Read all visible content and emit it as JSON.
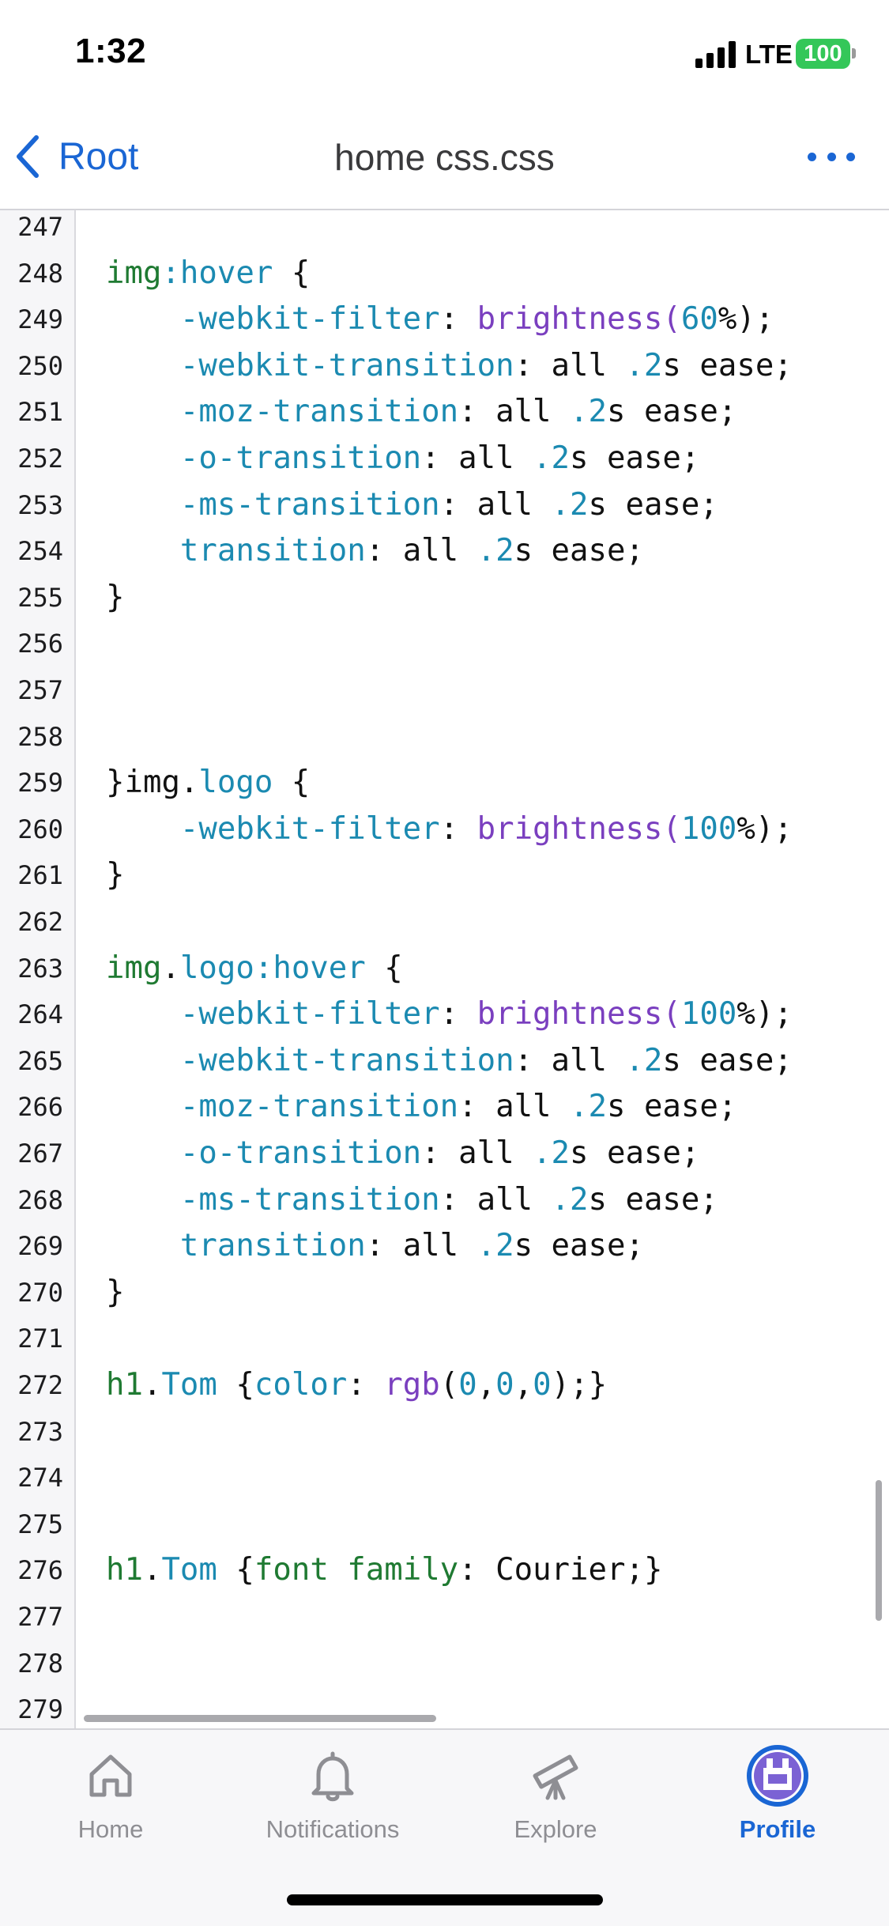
{
  "status_bar": {
    "time": "1:32",
    "network": "LTE",
    "battery": "100",
    "battery_color": "#34c759"
  },
  "nav": {
    "back_label": "Root",
    "title": "home css.css",
    "more_icon": "ellipsis-icon"
  },
  "colors": {
    "accent": "#1a66d4",
    "selector": "#1f7a32",
    "property": "#1b8ab1",
    "function": "#7a3fbf",
    "number": "#1b8ab1"
  },
  "code": {
    "lines": [
      {
        "num": "247",
        "tokens": []
      },
      {
        "num": "248",
        "tokens": [
          {
            "t": "img",
            "c": "sel"
          },
          {
            "t": ":hover",
            "c": "prop"
          },
          {
            "t": " {",
            "c": "plain"
          }
        ]
      },
      {
        "num": "249",
        "tokens": [
          {
            "t": "    -webkit-filter",
            "c": "prop"
          },
          {
            "t": ": ",
            "c": "plain"
          },
          {
            "t": "brightness",
            "c": "fn"
          },
          {
            "t": "(",
            "c": "fn"
          },
          {
            "t": "60",
            "c": "num"
          },
          {
            "t": "%);",
            "c": "plain"
          }
        ]
      },
      {
        "num": "250",
        "tokens": [
          {
            "t": "    -webkit-transition",
            "c": "prop"
          },
          {
            "t": ": all ",
            "c": "plain"
          },
          {
            "t": ".2",
            "c": "num"
          },
          {
            "t": "s ease;",
            "c": "plain"
          }
        ]
      },
      {
        "num": "251",
        "tokens": [
          {
            "t": "    -moz-transition",
            "c": "prop"
          },
          {
            "t": ": all ",
            "c": "plain"
          },
          {
            "t": ".2",
            "c": "num"
          },
          {
            "t": "s ease;",
            "c": "plain"
          }
        ]
      },
      {
        "num": "252",
        "tokens": [
          {
            "t": "    -o-transition",
            "c": "prop"
          },
          {
            "t": ": all ",
            "c": "plain"
          },
          {
            "t": ".2",
            "c": "num"
          },
          {
            "t": "s ease;",
            "c": "plain"
          }
        ]
      },
      {
        "num": "253",
        "tokens": [
          {
            "t": "    -ms-transition",
            "c": "prop"
          },
          {
            "t": ": all ",
            "c": "plain"
          },
          {
            "t": ".2",
            "c": "num"
          },
          {
            "t": "s ease;",
            "c": "plain"
          }
        ]
      },
      {
        "num": "254",
        "tokens": [
          {
            "t": "    transition",
            "c": "prop"
          },
          {
            "t": ": all ",
            "c": "plain"
          },
          {
            "t": ".2",
            "c": "num"
          },
          {
            "t": "s ease;",
            "c": "plain"
          }
        ]
      },
      {
        "num": "255",
        "tokens": [
          {
            "t": "}",
            "c": "plain"
          }
        ]
      },
      {
        "num": "256",
        "tokens": []
      },
      {
        "num": "257",
        "tokens": []
      },
      {
        "num": "258",
        "tokens": []
      },
      {
        "num": "259",
        "tokens": [
          {
            "t": "}img.",
            "c": "plain"
          },
          {
            "t": "logo",
            "c": "prop"
          },
          {
            "t": " {",
            "c": "plain"
          }
        ]
      },
      {
        "num": "260",
        "tokens": [
          {
            "t": "    -webkit-filter",
            "c": "prop"
          },
          {
            "t": ": ",
            "c": "plain"
          },
          {
            "t": "brightness",
            "c": "fn"
          },
          {
            "t": "(",
            "c": "fn"
          },
          {
            "t": "100",
            "c": "num"
          },
          {
            "t": "%);",
            "c": "plain"
          }
        ]
      },
      {
        "num": "261",
        "tokens": [
          {
            "t": "}",
            "c": "plain"
          }
        ]
      },
      {
        "num": "262",
        "tokens": []
      },
      {
        "num": "263",
        "tokens": [
          {
            "t": "img",
            "c": "sel"
          },
          {
            "t": ".",
            "c": "plain"
          },
          {
            "t": "logo",
            "c": "prop"
          },
          {
            "t": ":hover",
            "c": "prop"
          },
          {
            "t": " {",
            "c": "plain"
          }
        ]
      },
      {
        "num": "264",
        "tokens": [
          {
            "t": "    -webkit-filter",
            "c": "prop"
          },
          {
            "t": ": ",
            "c": "plain"
          },
          {
            "t": "brightness",
            "c": "fn"
          },
          {
            "t": "(",
            "c": "fn"
          },
          {
            "t": "100",
            "c": "num"
          },
          {
            "t": "%);",
            "c": "plain"
          }
        ]
      },
      {
        "num": "265",
        "tokens": [
          {
            "t": "    -webkit-transition",
            "c": "prop"
          },
          {
            "t": ": all ",
            "c": "plain"
          },
          {
            "t": ".2",
            "c": "num"
          },
          {
            "t": "s ease;",
            "c": "plain"
          }
        ]
      },
      {
        "num": "266",
        "tokens": [
          {
            "t": "    -moz-transition",
            "c": "prop"
          },
          {
            "t": ": all ",
            "c": "plain"
          },
          {
            "t": ".2",
            "c": "num"
          },
          {
            "t": "s ease;",
            "c": "plain"
          }
        ]
      },
      {
        "num": "267",
        "tokens": [
          {
            "t": "    -o-transition",
            "c": "prop"
          },
          {
            "t": ": all ",
            "c": "plain"
          },
          {
            "t": ".2",
            "c": "num"
          },
          {
            "t": "s ease;",
            "c": "plain"
          }
        ]
      },
      {
        "num": "268",
        "tokens": [
          {
            "t": "    -ms-transition",
            "c": "prop"
          },
          {
            "t": ": all ",
            "c": "plain"
          },
          {
            "t": ".2",
            "c": "num"
          },
          {
            "t": "s ease;",
            "c": "plain"
          }
        ]
      },
      {
        "num": "269",
        "tokens": [
          {
            "t": "    transition",
            "c": "prop"
          },
          {
            "t": ": all ",
            "c": "plain"
          },
          {
            "t": ".2",
            "c": "num"
          },
          {
            "t": "s ease;",
            "c": "plain"
          }
        ]
      },
      {
        "num": "270",
        "tokens": [
          {
            "t": "}",
            "c": "plain"
          }
        ]
      },
      {
        "num": "271",
        "tokens": []
      },
      {
        "num": "272",
        "tokens": [
          {
            "t": "h1",
            "c": "sel"
          },
          {
            "t": ".",
            "c": "plain"
          },
          {
            "t": "Tom",
            "c": "prop"
          },
          {
            "t": " {",
            "c": "plain"
          },
          {
            "t": "color",
            "c": "prop"
          },
          {
            "t": ": ",
            "c": "plain"
          },
          {
            "t": "rgb",
            "c": "fn"
          },
          {
            "t": "(",
            "c": "plain"
          },
          {
            "t": "0",
            "c": "num"
          },
          {
            "t": ",",
            "c": "plain"
          },
          {
            "t": "0",
            "c": "num"
          },
          {
            "t": ",",
            "c": "plain"
          },
          {
            "t": "0",
            "c": "num"
          },
          {
            "t": ");}",
            "c": "plain"
          }
        ]
      },
      {
        "num": "273",
        "tokens": []
      },
      {
        "num": "274",
        "tokens": []
      },
      {
        "num": "275",
        "tokens": []
      },
      {
        "num": "276",
        "tokens": [
          {
            "t": "h1",
            "c": "sel"
          },
          {
            "t": ".",
            "c": "plain"
          },
          {
            "t": "Tom",
            "c": "prop"
          },
          {
            "t": " {",
            "c": "plain"
          },
          {
            "t": "font family",
            "c": "sel"
          },
          {
            "t": ": Courier;}",
            "c": "plain"
          }
        ]
      },
      {
        "num": "277",
        "tokens": []
      },
      {
        "num": "278",
        "tokens": []
      },
      {
        "num": "279",
        "tokens": []
      }
    ]
  },
  "tabs": [
    {
      "label": "Home",
      "icon": "house-icon",
      "active": false
    },
    {
      "label": "Notifications",
      "icon": "bell-icon",
      "active": false
    },
    {
      "label": "Explore",
      "icon": "telescope-icon",
      "active": false
    },
    {
      "label": "Profile",
      "icon": "avatar-icon",
      "active": true
    }
  ]
}
